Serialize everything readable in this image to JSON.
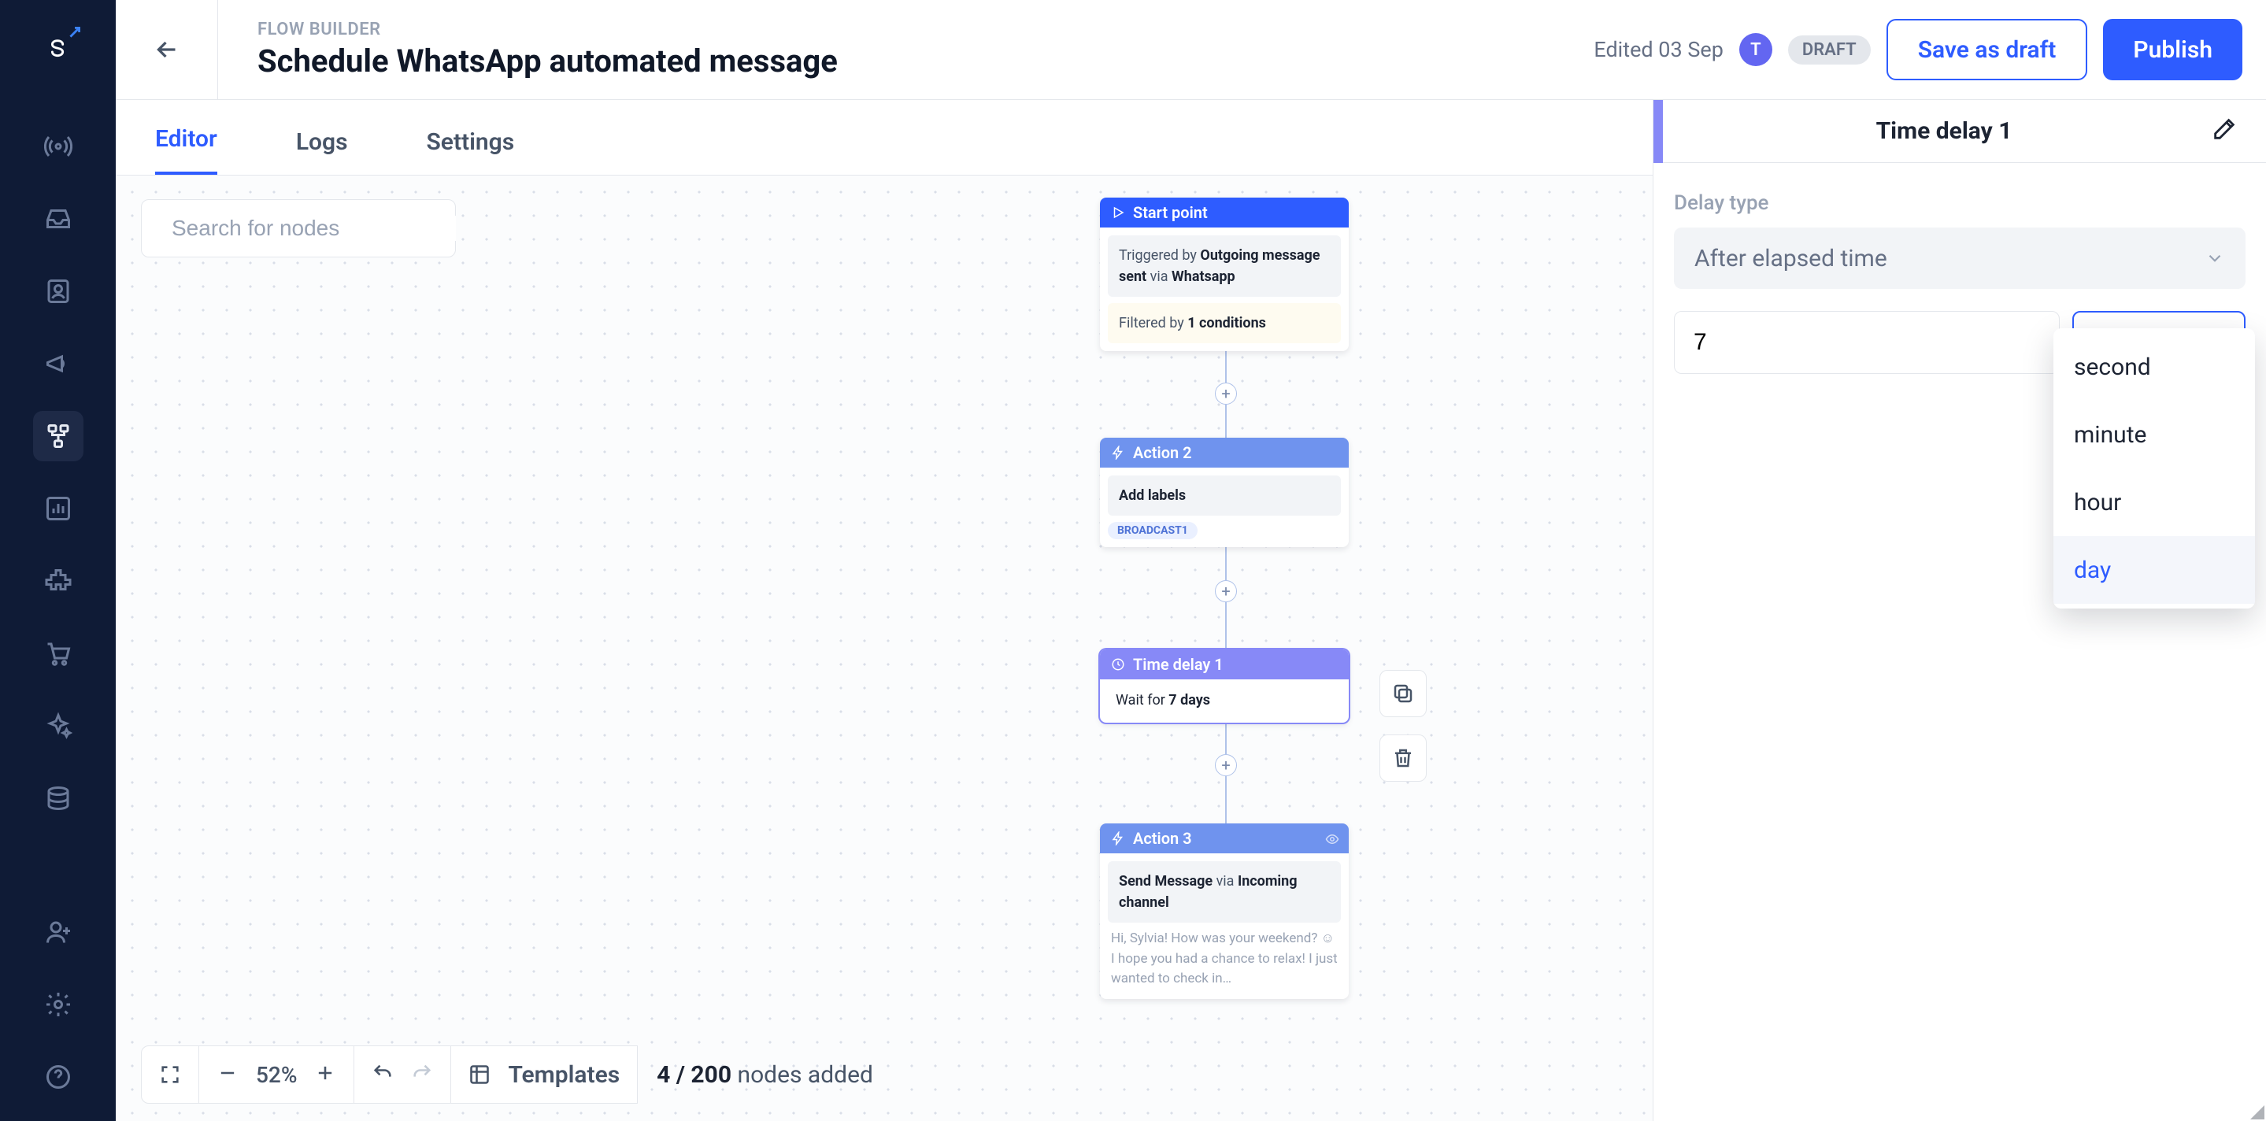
{
  "nav": {
    "logo_letter": "S"
  },
  "header": {
    "breadcrumb": "FLOW BUILDER",
    "title": "Schedule WhatsApp automated message",
    "edited": "Edited 03 Sep",
    "avatar_initial": "T",
    "draft_badge": "DRAFT",
    "save_draft": "Save as draft",
    "publish": "Publish"
  },
  "tabs": {
    "editor": "Editor",
    "logs": "Logs",
    "settings": "Settings"
  },
  "search": {
    "placeholder": "Search for nodes"
  },
  "nodes": {
    "start": {
      "title": "Start point",
      "trigger_pre": "Triggered by ",
      "trigger_bold": "Outgoing message sent",
      "trigger_mid": " via ",
      "trigger_channel": "Whatsapp",
      "filter_pre": "Filtered by ",
      "filter_bold": "1 conditions"
    },
    "action2": {
      "title": "Action 2",
      "body": "Add labels",
      "chip": "BROADCAST1"
    },
    "delay": {
      "title": "Time delay 1",
      "wait_pre": "Wait for ",
      "wait_bold": "7 days"
    },
    "action3": {
      "title": "Action 3",
      "body_bold1": "Send Message",
      "body_mid": " via ",
      "body_bold2": "Incoming channel",
      "preview": "Hi, Sylvia! How was your weekend? ☺ I hope you had a chance to relax! I just wanted to check in…"
    }
  },
  "bottom": {
    "zoom": "52%",
    "templates": "Templates",
    "count_current": "4",
    "count_sep": " / ",
    "count_total": "200",
    "count_label": " nodes added"
  },
  "panel": {
    "title": "Time delay 1",
    "delay_type_label": "Delay type",
    "delay_type_value": "After elapsed time",
    "value": "7",
    "unit": "day",
    "options": {
      "second": "second",
      "minute": "minute",
      "hour": "hour",
      "day": "day"
    }
  }
}
